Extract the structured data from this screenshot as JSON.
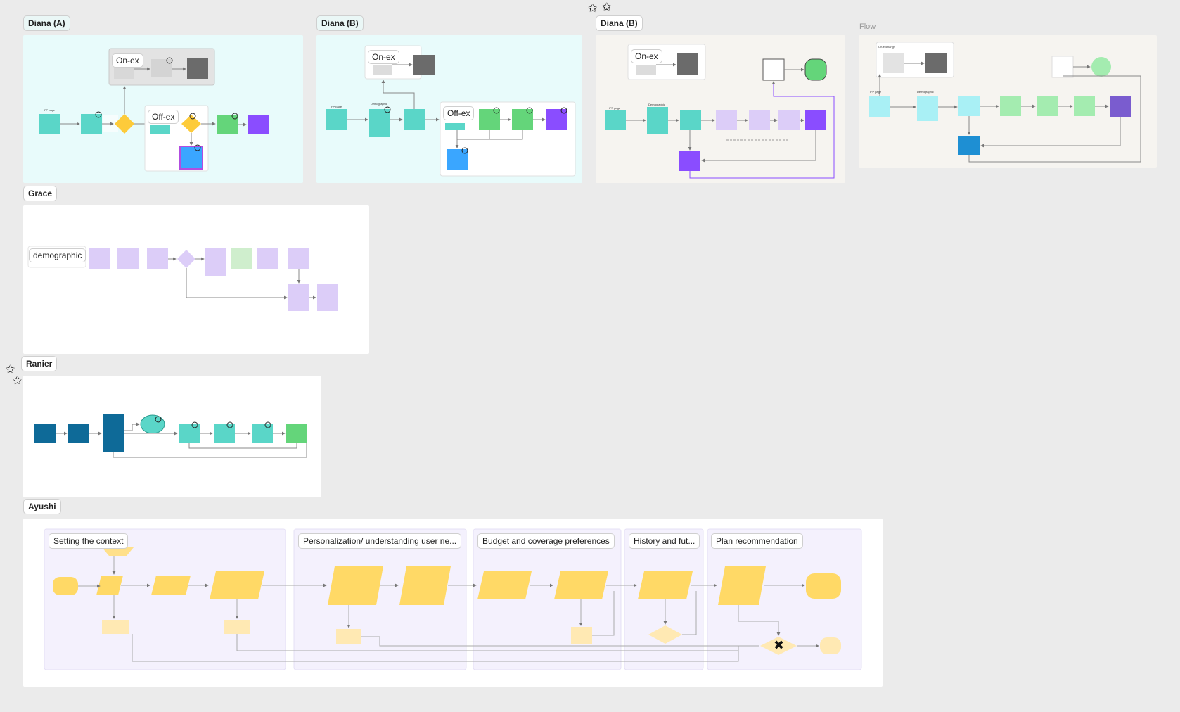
{
  "sections": {
    "diana_a": "Diana (A)",
    "diana_b1": "Diana (B)",
    "diana_b2": "Diana (B)",
    "flow": "Flow",
    "grace": "Grace",
    "ranier": "Ranier",
    "ayushi": "Ayushi"
  },
  "diana_a": {
    "on_ex": "On-ex",
    "off_ex": "Off-ex",
    "ifp_page": "IFP page"
  },
  "diana_b1": {
    "on_ex": "On-ex",
    "off_ex": "Off-ex",
    "ifp_page": "IFP page",
    "demographic": "Demographic"
  },
  "diana_b2": {
    "on_ex": "On-ex",
    "ifp_page": "IFP page",
    "demographic": "Demographic"
  },
  "flow": {
    "on_exchange": "On-exchange",
    "ifp_page": "IFP page",
    "demographic": "Demographic"
  },
  "grace": {
    "demographic": "demographic"
  },
  "ayushi": {
    "groups": [
      "Setting the context",
      "Personalization/ understanding user ne...",
      "Budget and coverage preferences",
      "History and fut...",
      "Plan recommendation"
    ]
  },
  "colors": {
    "teal": "#5ad6c8",
    "green": "#64d57a",
    "purple": "#8a4dff",
    "blue": "#3aa6ff",
    "gray": "#6b6b6b",
    "lavender": "#dccdf8",
    "yellow": "#ffd966",
    "navy": "#0e6a98"
  },
  "icons": {
    "star_sticker": "star-sticker-icon",
    "cross_sticker": "cross-sticker-icon"
  }
}
